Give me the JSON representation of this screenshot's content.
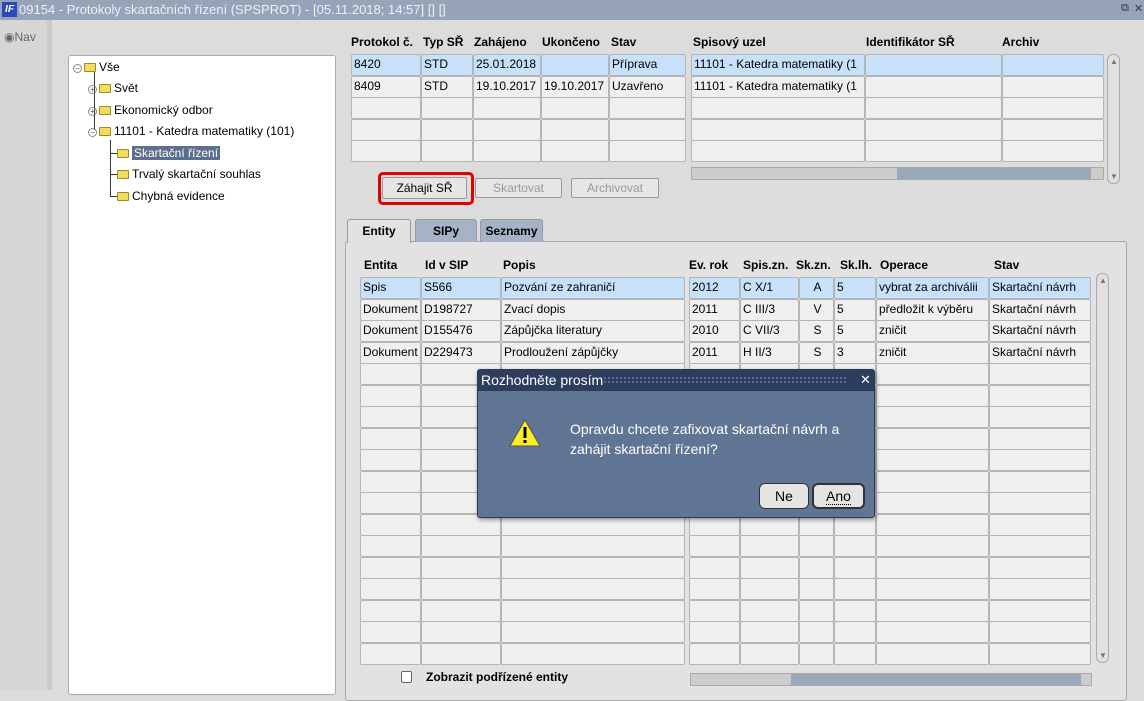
{
  "window": {
    "title": "09154 - Protokoly skartačních řízení (SPSPROT) - [05.11.2018; 14:57] [] []",
    "app_icon": "IF",
    "restore_icon": "restore-icon",
    "close_icon": "close-icon"
  },
  "nav": {
    "label": "Nav"
  },
  "tree": {
    "nodes": [
      {
        "label": "Vše",
        "expanded": true
      },
      {
        "label": "Svět",
        "expanded": false
      },
      {
        "label": "Ekonomický odbor",
        "expanded": false
      },
      {
        "label": "11101 - Katedra matematiky (101)",
        "expanded": true
      },
      {
        "label": "Skartační řízení",
        "selected": true
      },
      {
        "label": "Trvalý skartační souhlas"
      },
      {
        "label": "Chybná evidence"
      }
    ]
  },
  "protocols": {
    "headers": [
      "Protokol č.",
      "Typ SŘ",
      "Zahájeno",
      "Ukončeno",
      "Stav",
      "Spisový uzel",
      "Identifikátor SŘ",
      "Archiv"
    ],
    "rows": [
      [
        "8420",
        "STD",
        "25.01.2018",
        "",
        "Příprava",
        "11101 - Katedra matematiky (1",
        "",
        ""
      ],
      [
        "8409",
        "STD",
        "19.10.2017",
        "19.10.2017",
        "Uzavřeno",
        "11101 - Katedra matematiky (1",
        "",
        ""
      ]
    ],
    "selected_row": 0
  },
  "buttons": {
    "start": "Záhajit SŘ",
    "shred": "Skartovat",
    "archive": "Archivovat"
  },
  "tabs": [
    {
      "label": "Entity",
      "active": true
    },
    {
      "label": "SIPy"
    },
    {
      "label": "Seznamy"
    }
  ],
  "entities": {
    "headers": [
      "Entita",
      "Id v SIP",
      "Popis",
      "Ev. rok",
      "Spis.zn.",
      "Sk.zn.",
      "Sk.lh.",
      "Operace",
      "Stav"
    ],
    "rows": [
      [
        "Spis",
        "S566",
        "Pozvání ze zahraničí",
        "2012",
        "C X/1",
        "A",
        "5",
        "vybrat za archiválii",
        "Skartační návrh"
      ],
      [
        "Dokument",
        "D198727",
        "Zvací dopis",
        "2011",
        "C III/3",
        "V",
        "5",
        "předložit k výběru",
        "Skartační návrh"
      ],
      [
        "Dokument",
        "D155476",
        "Zápůjčka literatury",
        "2010",
        "C VII/3",
        "S",
        "5",
        "zničit",
        "Skartační návrh"
      ],
      [
        "Dokument",
        "D229473",
        "Prodloužení zápůjčky",
        "2011",
        "H II/3",
        "S",
        "3",
        "zničit",
        "Skartační návrh"
      ]
    ],
    "selected_row": 0,
    "show_children_label": "Zobrazit podřízené entity",
    "show_children_checked": false
  },
  "dialog": {
    "title": "Rozhodněte prosím",
    "message": "Opravdu chcete zafixovat skartační návrh a zahájit skartační řízení?",
    "no": "Ne",
    "yes": "Ano",
    "icon": "warning-icon"
  },
  "colors": {
    "selection": "#c8e1fa",
    "title_bar": "#97a3b8",
    "dialog": "#5f7593",
    "highlight": "#e00000"
  }
}
